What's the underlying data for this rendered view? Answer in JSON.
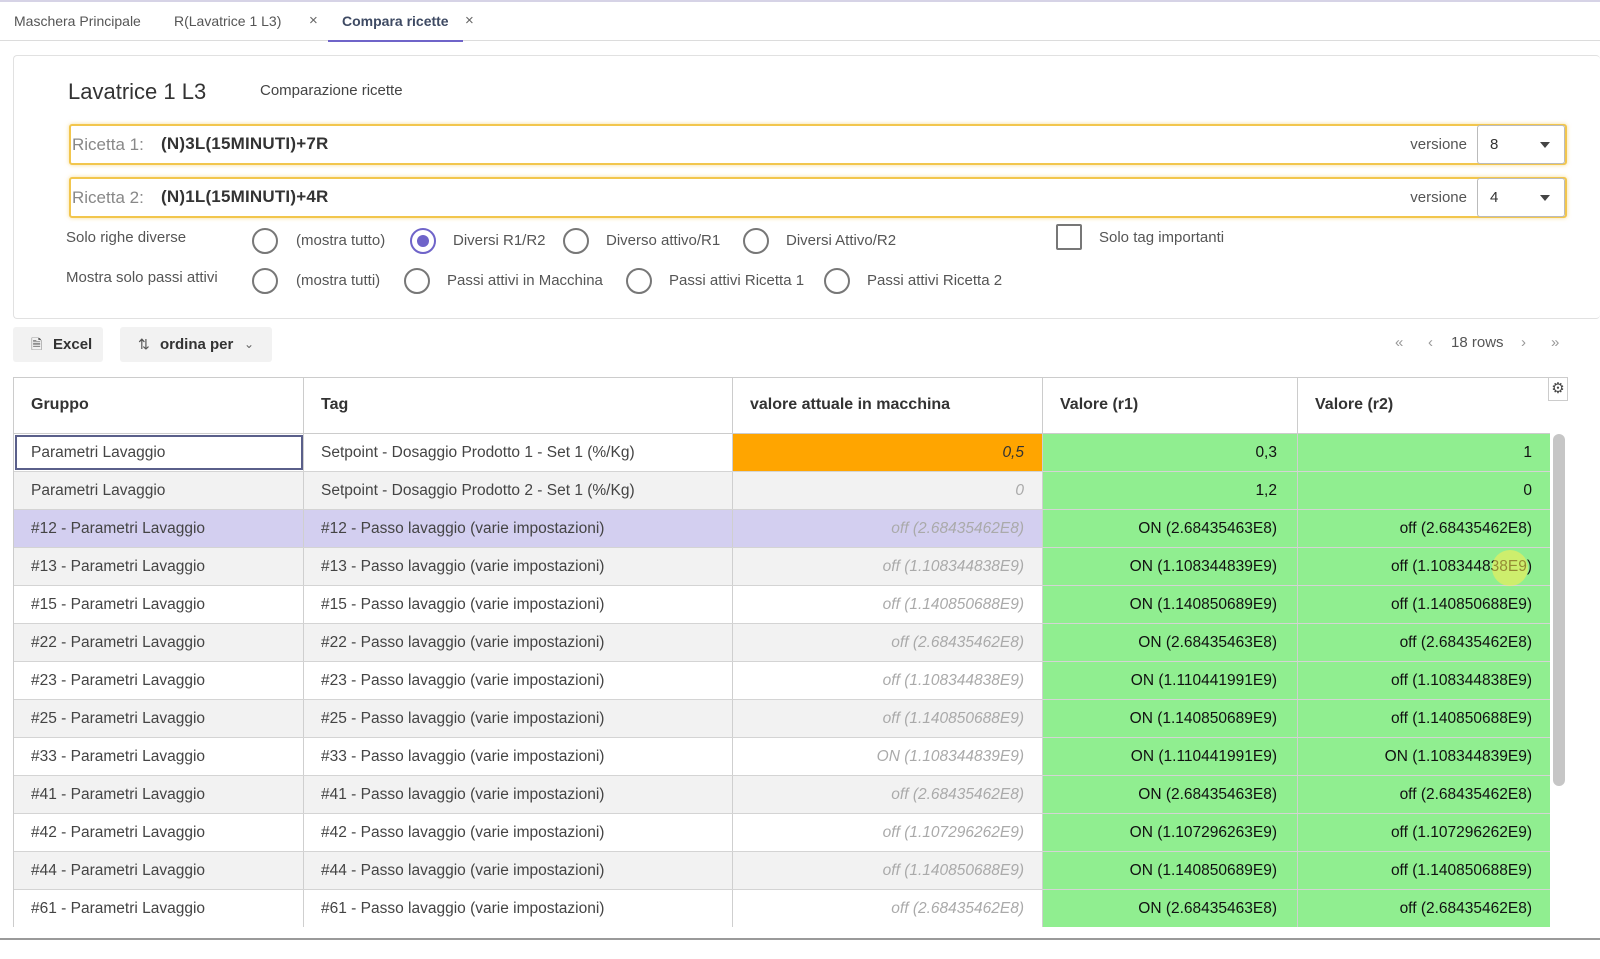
{
  "tabs": [
    {
      "label": "Maschera Principale"
    },
    {
      "label": "R(Lavatrice 1 L3)",
      "close": "×"
    },
    {
      "label": "Compara ricette",
      "close": "×"
    }
  ],
  "header": {
    "machine": "Lavatrice 1 L3",
    "subtitle": "Comparazione ricette"
  },
  "recipe1": {
    "label": "Ricetta 1:",
    "value": "(N)3L(15MINUTI)+7R",
    "version_label": "versione",
    "version": "8"
  },
  "recipe2": {
    "label": "Ricetta 2:",
    "value": "(N)1L(15MINUTI)+4R",
    "version_label": "versione",
    "version": "4"
  },
  "filter_diff": {
    "label": "Solo righe diverse",
    "options": [
      "(mostra tutto)",
      "Diversi R1/R2",
      "Diverso attivo/R1",
      "Diversi Attivo/R2"
    ],
    "selected": "Diversi R1/R2"
  },
  "important_tags": {
    "label": "Solo tag importanti",
    "checked": false
  },
  "filter_active": {
    "label": "Mostra solo passi attivi",
    "options": [
      "(mostra tutti)",
      "Passi attivi in Macchina",
      "Passi attivi Ricetta 1",
      "Passi attivi Ricetta 2"
    ],
    "selected": null
  },
  "toolbar": {
    "excel": "Excel",
    "sort": "ordina per"
  },
  "pager": {
    "first": "«",
    "prev": "‹",
    "rows": "18 rows",
    "next": "›",
    "last": "»"
  },
  "columns": [
    "Gruppo",
    "Tag",
    "valore attuale in macchina",
    "Valore (r1)",
    "Valore (r2)"
  ],
  "rows": [
    {
      "gruppo": "Parametri Lavaggio",
      "tag": "Setpoint - Dosaggio Prodotto 1 - Set 1 (%/Kg)",
      "attuale": "0,5",
      "r1": "0,3",
      "r2": "1"
    },
    {
      "gruppo": "Parametri Lavaggio",
      "tag": "Setpoint - Dosaggio Prodotto 2 - Set 1 (%/Kg)",
      "attuale": "0",
      "r1": "1,2",
      "r2": "0"
    },
    {
      "gruppo": "#12 - Parametri Lavaggio",
      "tag": "#12 - Passo lavaggio (varie impostazioni)",
      "attuale": "off (2.68435462E8)",
      "r1": "ON (2.68435463E8)",
      "r2": "off (2.68435462E8)"
    },
    {
      "gruppo": "#13 - Parametri Lavaggio",
      "tag": "#13 - Passo lavaggio (varie impostazioni)",
      "attuale": "off (1.108344838E9)",
      "r1": "ON (1.108344839E9)",
      "r2": "off (1.108344838E9)"
    },
    {
      "gruppo": "#15 - Parametri Lavaggio",
      "tag": "#15 - Passo lavaggio (varie impostazioni)",
      "attuale": "off (1.140850688E9)",
      "r1": "ON (1.140850689E9)",
      "r2": "off (1.140850688E9)"
    },
    {
      "gruppo": "#22 - Parametri Lavaggio",
      "tag": "#22 - Passo lavaggio (varie impostazioni)",
      "attuale": "off (2.68435462E8)",
      "r1": "ON (2.68435463E8)",
      "r2": "off (2.68435462E8)"
    },
    {
      "gruppo": "#23 - Parametri Lavaggio",
      "tag": "#23 - Passo lavaggio (varie impostazioni)",
      "attuale": "off (1.108344838E9)",
      "r1": "ON (1.110441991E9)",
      "r2": "off (1.108344838E9)"
    },
    {
      "gruppo": "#25 - Parametri Lavaggio",
      "tag": "#25 - Passo lavaggio (varie impostazioni)",
      "attuale": "off (1.140850688E9)",
      "r1": "ON (1.140850689E9)",
      "r2": "off (1.140850688E9)"
    },
    {
      "gruppo": "#33 - Parametri Lavaggio",
      "tag": "#33 - Passo lavaggio (varie impostazioni)",
      "attuale": "ON (1.108344839E9)",
      "r1": "ON (1.110441991E9)",
      "r2": "ON (1.108344839E9)"
    },
    {
      "gruppo": "#41 - Parametri Lavaggio",
      "tag": "#41 - Passo lavaggio (varie impostazioni)",
      "attuale": "off (2.68435462E8)",
      "r1": "ON (2.68435463E8)",
      "r2": "off (2.68435462E8)"
    },
    {
      "gruppo": "#42 - Parametri Lavaggio",
      "tag": "#42 - Passo lavaggio (varie impostazioni)",
      "attuale": "off (1.107296262E9)",
      "r1": "ON (1.107296263E9)",
      "r2": "off (1.107296262E9)"
    },
    {
      "gruppo": "#44 - Parametri Lavaggio",
      "tag": "#44 - Passo lavaggio (varie impostazioni)",
      "attuale": "off (1.140850688E9)",
      "r1": "ON (1.140850689E9)",
      "r2": "off (1.140850688E9)"
    },
    {
      "gruppo": "#61 - Parametri Lavaggio",
      "tag": "#61 - Passo lavaggio (varie impostazioni)",
      "attuale": "off (2.68435462E8)",
      "r1": "ON (2.68435463E8)",
      "r2": "off (2.68435462E8)"
    }
  ],
  "colors": {
    "accent": "#6f64c9",
    "diff_highlight": "#ffa500",
    "match_green": "#90ee90",
    "field_border": "#f2c64d"
  }
}
